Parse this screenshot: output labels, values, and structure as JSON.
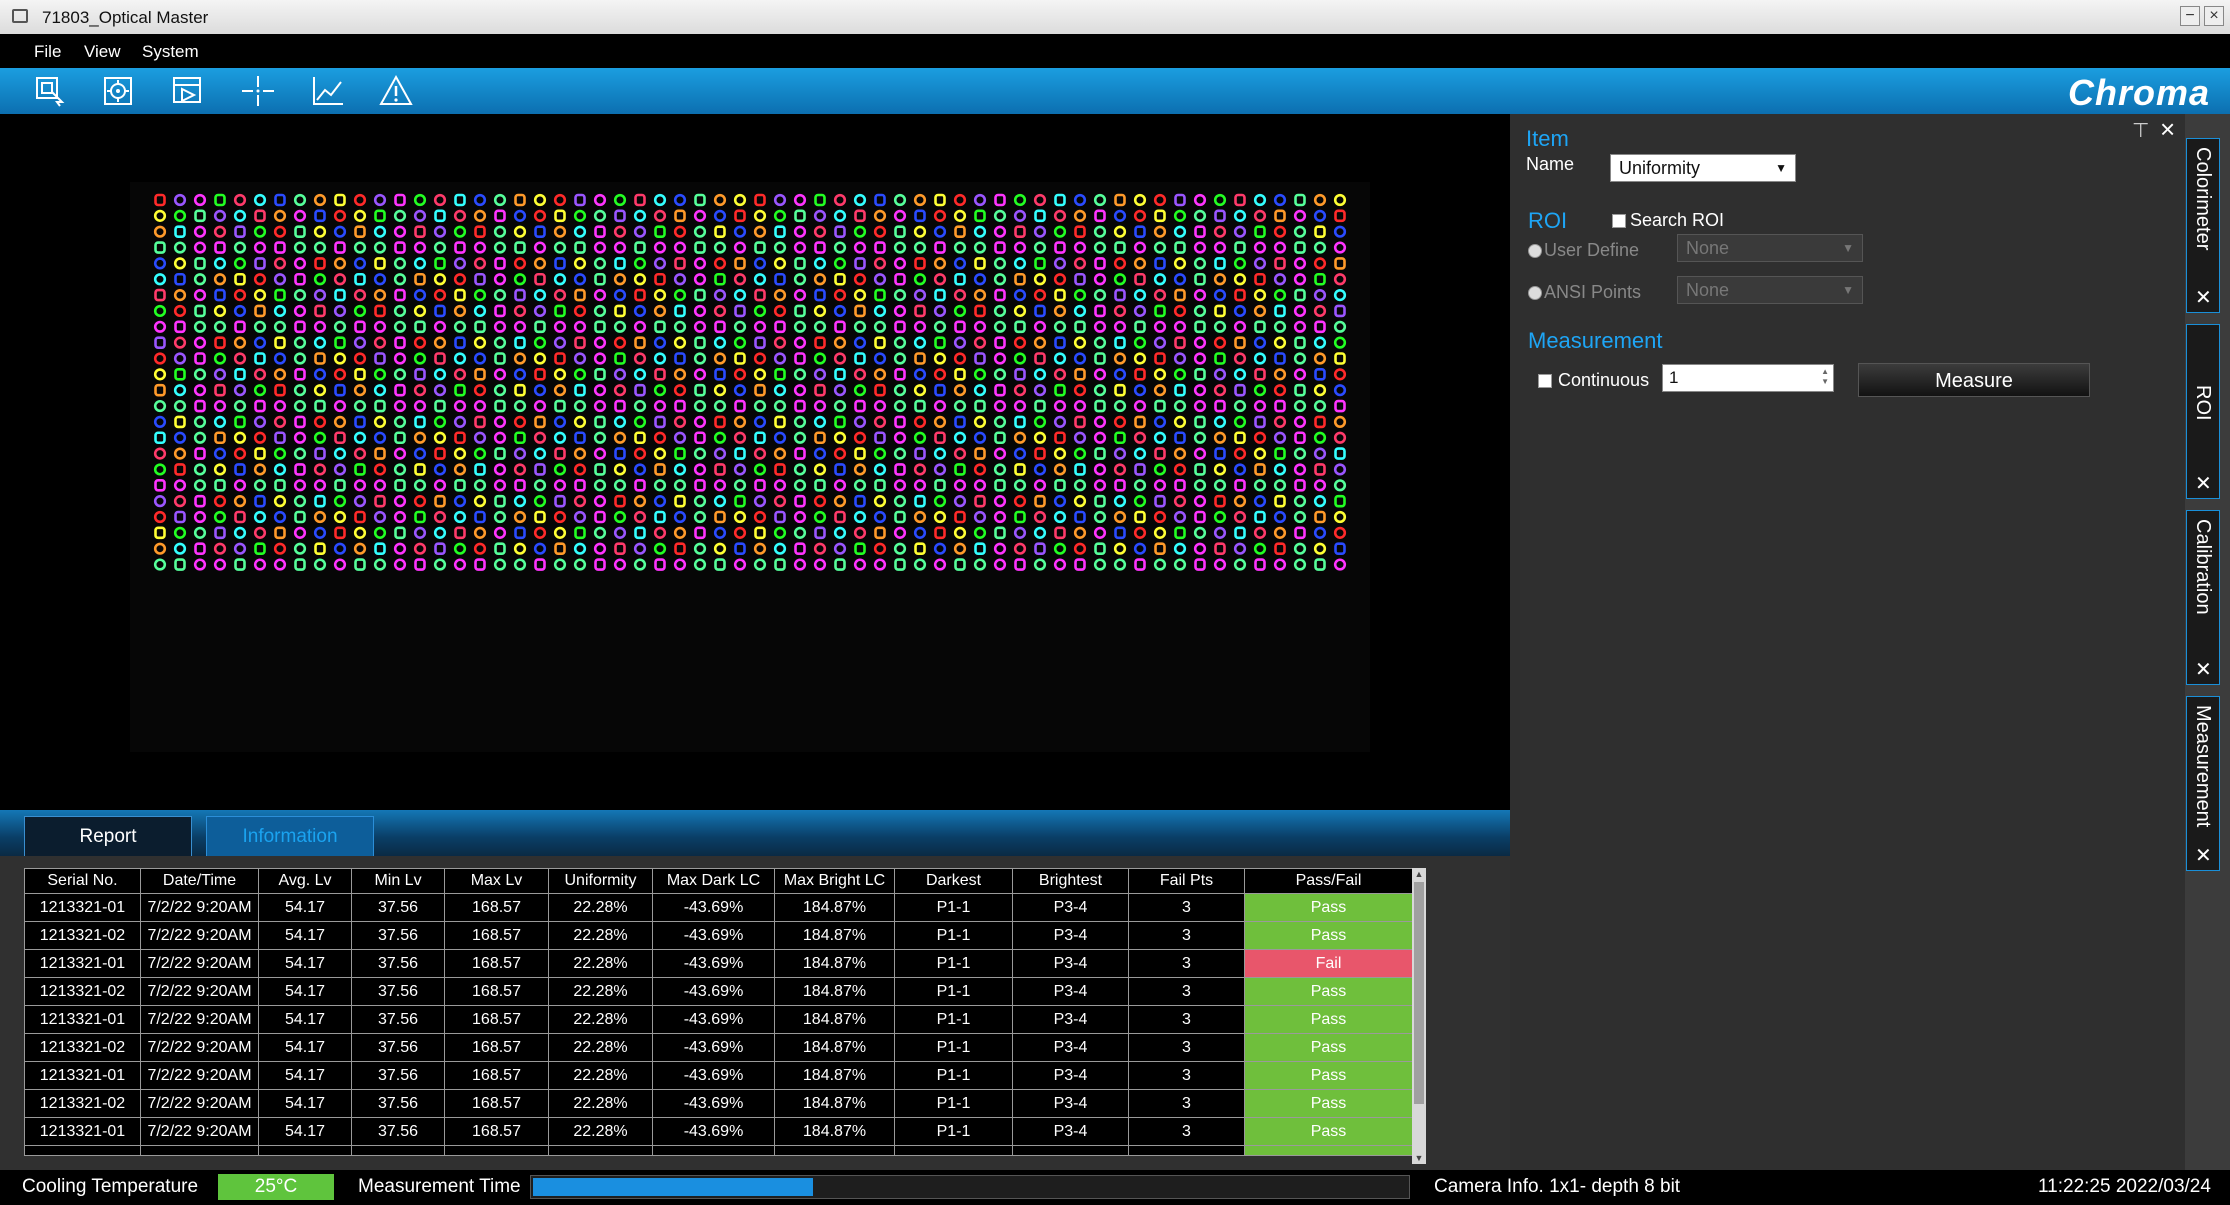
{
  "window": {
    "title": "71803_Optical Master"
  },
  "menu": [
    "File",
    "View",
    "System"
  ],
  "toolbar": {
    "tools": [
      "roi-select-icon",
      "target-settings-icon",
      "playback-icon",
      "crosshair-icon",
      "chart-icon",
      "warning-icon"
    ],
    "brand": "Chroma"
  },
  "tabs": {
    "report": "Report",
    "information": "Information"
  },
  "table": {
    "headers": [
      "Serial No.",
      "Date/Time",
      "Avg. Lv",
      "Min Lv",
      "Max Lv",
      "Uniformity",
      "Max Dark LC",
      "Max Bright LC",
      "Darkest",
      "Brightest",
      "Fail Pts",
      "Pass/Fail"
    ],
    "rows": [
      [
        "1213321-01",
        "7/2/22 9:20AM",
        "54.17",
        "37.56",
        "168.57",
        "22.28%",
        "-43.69%",
        "184.87%",
        "P1-1",
        "P3-4",
        "3",
        "Pass"
      ],
      [
        "1213321-02",
        "7/2/22 9:20AM",
        "54.17",
        "37.56",
        "168.57",
        "22.28%",
        "-43.69%",
        "184.87%",
        "P1-1",
        "P3-4",
        "3",
        "Pass"
      ],
      [
        "1213321-01",
        "7/2/22 9:20AM",
        "54.17",
        "37.56",
        "168.57",
        "22.28%",
        "-43.69%",
        "184.87%",
        "P1-1",
        "P3-4",
        "3",
        "Fail"
      ],
      [
        "1213321-02",
        "7/2/22 9:20AM",
        "54.17",
        "37.56",
        "168.57",
        "22.28%",
        "-43.69%",
        "184.87%",
        "P1-1",
        "P3-4",
        "3",
        "Pass"
      ],
      [
        "1213321-01",
        "7/2/22 9:20AM",
        "54.17",
        "37.56",
        "168.57",
        "22.28%",
        "-43.69%",
        "184.87%",
        "P1-1",
        "P3-4",
        "3",
        "Pass"
      ],
      [
        "1213321-02",
        "7/2/22 9:20AM",
        "54.17",
        "37.56",
        "168.57",
        "22.28%",
        "-43.69%",
        "184.87%",
        "P1-1",
        "P3-4",
        "3",
        "Pass"
      ],
      [
        "1213321-01",
        "7/2/22 9:20AM",
        "54.17",
        "37.56",
        "168.57",
        "22.28%",
        "-43.69%",
        "184.87%",
        "P1-1",
        "P3-4",
        "3",
        "Pass"
      ],
      [
        "1213321-02",
        "7/2/22 9:20AM",
        "54.17",
        "37.56",
        "168.57",
        "22.28%",
        "-43.69%",
        "184.87%",
        "P1-1",
        "P3-4",
        "3",
        "Pass"
      ],
      [
        "1213321-01",
        "7/2/22 9:20AM",
        "54.17",
        "37.56",
        "168.57",
        "22.28%",
        "-43.69%",
        "184.87%",
        "P1-1",
        "P3-4",
        "3",
        "Pass"
      ]
    ]
  },
  "panel": {
    "item_title": "Item",
    "name_label": "Name",
    "name_value": "Uniformity",
    "roi_title": "ROI",
    "search_roi_label": "Search ROI",
    "user_define_label": "User Define",
    "user_define_value": "None",
    "ansi_points_label": "ANSI Points",
    "ansi_points_value": "None",
    "measurement_title": "Measurement",
    "continuous_label": "Continuous",
    "count_value": "1",
    "measure_button": "Measure"
  },
  "dock": [
    "Colorimeter",
    "ROI",
    "Calibration",
    "Measurement"
  ],
  "status": {
    "cooling_label": "Cooling Temperature",
    "cooling_value": "25°C",
    "measurement_time_label": "Measurement Time",
    "measurement_progress": 0.32,
    "camera_info": "Camera Info. 1x1- depth 8 bit",
    "datetime": "11:22:25 2022/03/24"
  },
  "colors": {
    "accent": "#1ea5f5",
    "pass": "#6fbf3c",
    "fail": "#e8566b",
    "toolbar": "#1b9ee0",
    "dots": [
      "#ff2a2a",
      "#22ff22",
      "#2a4bff",
      "#ffff33",
      "#ff33ff",
      "#33ffff",
      "#ff9a2a",
      "#9a55ff",
      "#ff3a6a",
      "#55ff9a"
    ]
  }
}
